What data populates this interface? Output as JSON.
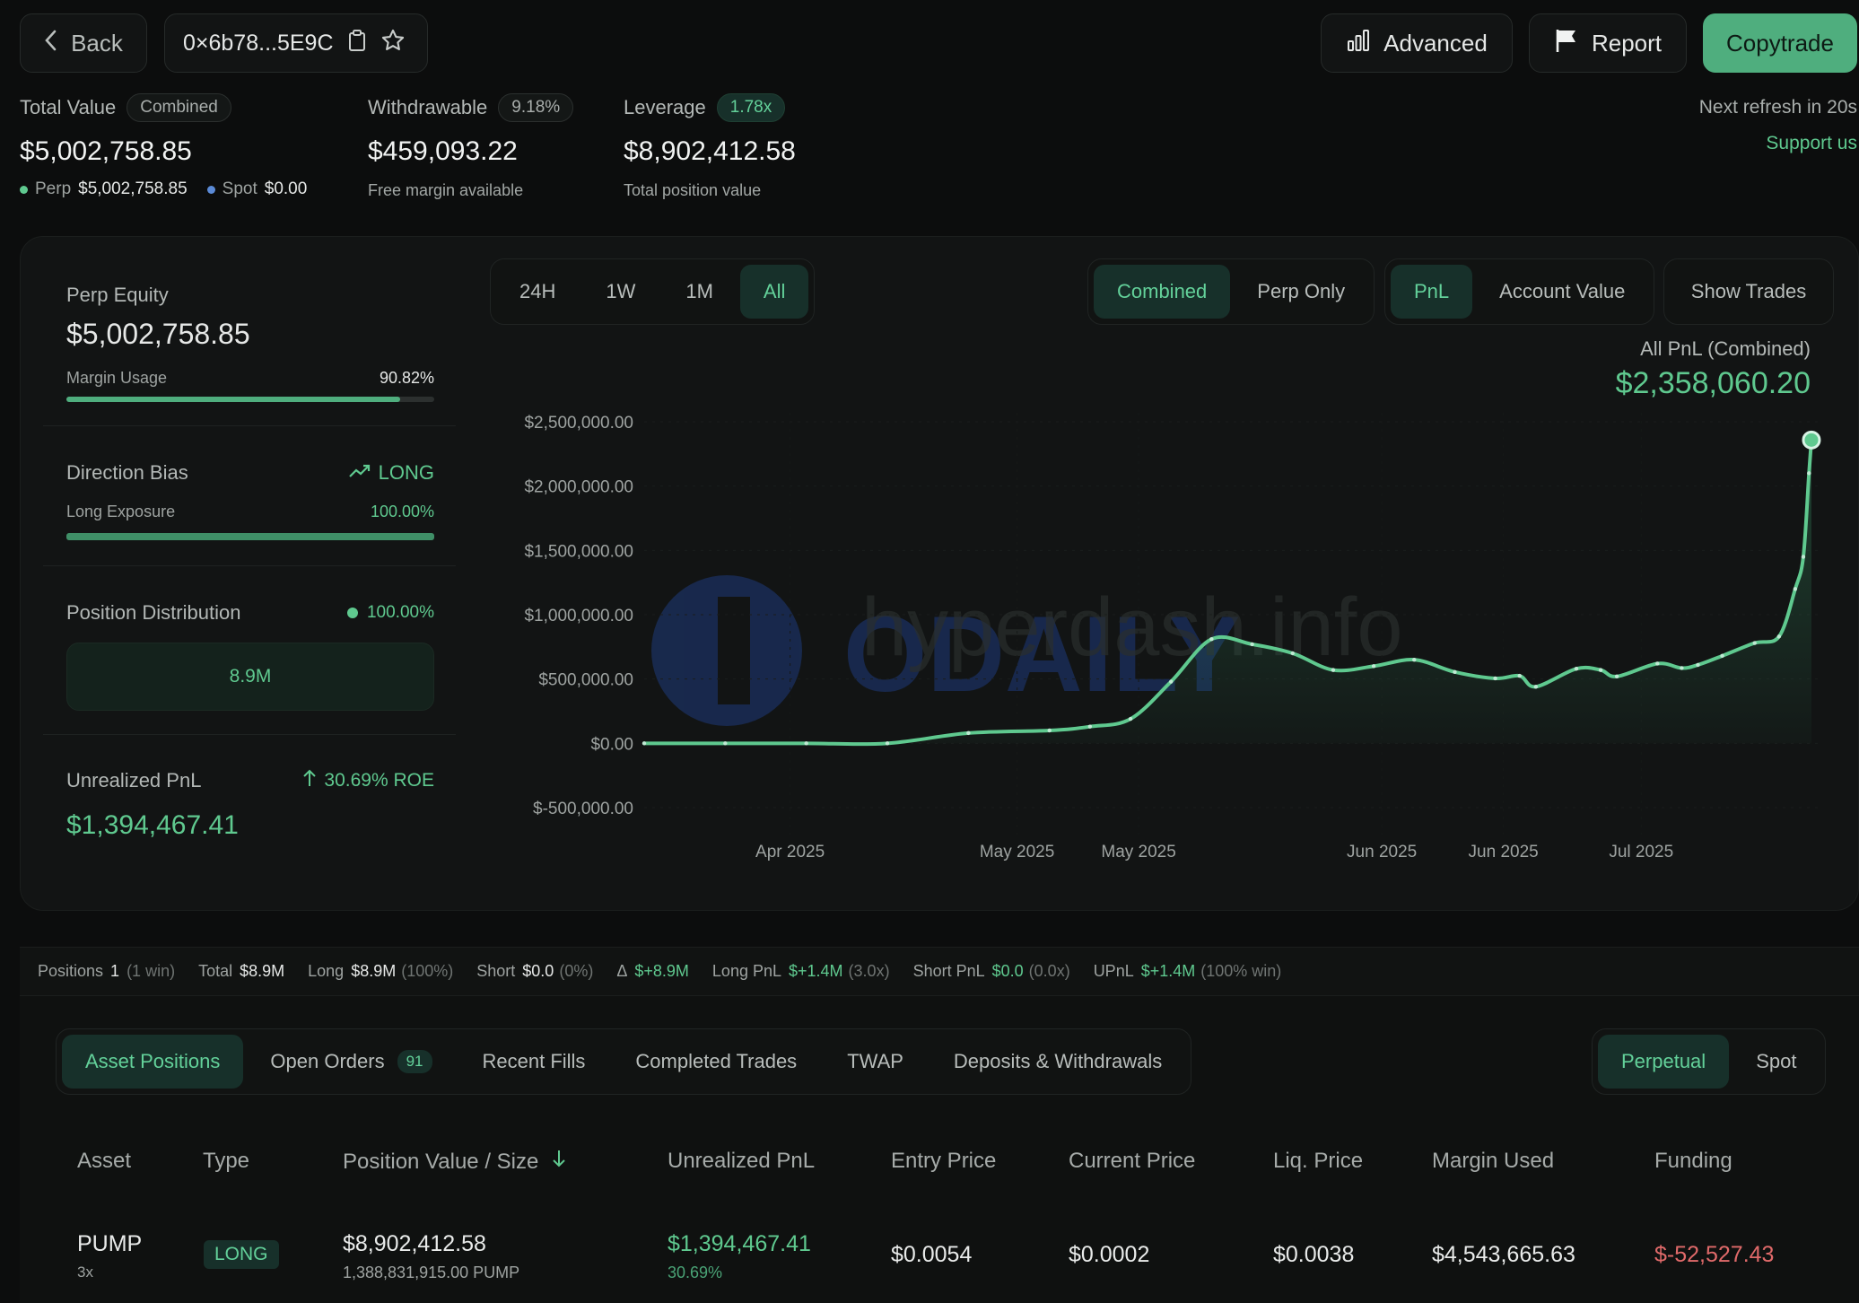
{
  "header": {
    "back_label": "Back",
    "address": "0×6b78...5E9C",
    "advanced_label": "Advanced",
    "report_label": "Report",
    "copytrade_label": "Copytrade"
  },
  "stats": {
    "total_value": {
      "label": "Total Value",
      "badge": "Combined",
      "value": "$5,002,758.85",
      "perp_label": "Perp",
      "perp_value": "$5,002,758.85",
      "spot_label": "Spot",
      "spot_value": "$0.00"
    },
    "withdrawable": {
      "label": "Withdrawable",
      "badge": "9.18%",
      "value": "$459,093.22",
      "sub": "Free margin available"
    },
    "leverage": {
      "label": "Leverage",
      "badge": "1.78x",
      "value": "$8,902,412.58",
      "sub": "Total position value"
    },
    "refresh": "Next refresh in 20s",
    "support": "Support us"
  },
  "left_panel": {
    "perp_equity_label": "Perp Equity",
    "perp_equity_value": "$5,002,758.85",
    "margin_usage_label": "Margin Usage",
    "margin_usage_value": "90.82%",
    "margin_usage_fraction": 0.9082,
    "direction_label": "Direction Bias",
    "direction_value": "LONG",
    "long_exposure_label": "Long Exposure",
    "long_exposure_value": "100.00%",
    "long_exposure_fraction": 1.0,
    "distribution_label": "Position Distribution",
    "distribution_value": "100.00%",
    "distribution_box": "8.9M",
    "upnl_label": "Unrealized PnL",
    "upnl_roe": "30.69% ROE",
    "upnl_value": "$1,394,467.41"
  },
  "chart_controls": {
    "ranges": [
      "24H",
      "1W",
      "1M",
      "All"
    ],
    "active_range": "All",
    "modes": [
      "Combined",
      "Perp Only"
    ],
    "metrics": [
      "PnL",
      "Account Value"
    ],
    "show_trades": "Show Trades"
  },
  "chart_data": {
    "type": "area",
    "title": "All PnL (Combined)",
    "headline_value": "$2,358,060.20",
    "ylim": [
      -500000,
      2500000
    ],
    "y_ticks": [
      2500000,
      2000000,
      1500000,
      1000000,
      500000,
      0,
      -500000
    ],
    "y_tick_labels": [
      "$2,500,000.00",
      "$2,000,000.00",
      "$1,500,000.00",
      "$1,000,000.00",
      "$500,000.00",
      "$0.00",
      "$-500,000.00"
    ],
    "x_tick_labels": [
      "Apr 2025",
      "May 2025",
      "May 2025",
      "Jun 2025",
      "Jun 2025",
      "Jul 2025"
    ],
    "x_tick_days": [
      18,
      46,
      61,
      91,
      106,
      123
    ],
    "xlim_days": [
      0,
      145
    ],
    "series": [
      {
        "x_days": [
          0,
          10,
          20,
          30,
          40,
          50,
          55,
          60,
          65,
          70,
          75,
          80,
          85,
          90,
          95,
          100,
          105,
          108,
          110,
          115,
          118,
          120,
          125,
          128,
          130,
          133,
          137,
          140,
          142,
          143,
          143.7,
          144
        ],
        "values": [
          0,
          0,
          0,
          0,
          80000,
          100000,
          130000,
          190000,
          480000,
          810000,
          770000,
          700000,
          570000,
          600000,
          650000,
          555000,
          505000,
          525000,
          440000,
          580000,
          570000,
          520000,
          620000,
          585000,
          610000,
          680000,
          780000,
          830000,
          1200000,
          1450000,
          2100000,
          2358060
        ]
      }
    ]
  },
  "summary_bar": {
    "positions_label": "Positions",
    "positions_value": "1",
    "positions_note": "(1 win)",
    "total_label": "Total",
    "total_value": "$8.9M",
    "long_label": "Long",
    "long_value": "$8.9M",
    "long_note": "(100%)",
    "short_label": "Short",
    "short_value": "$0.0",
    "short_note": "(0%)",
    "delta_label": "Δ",
    "delta_value": "$+8.9M",
    "long_pnl_label": "Long PnL",
    "long_pnl_value": "$+1.4M",
    "long_pnl_note": "(3.0x)",
    "short_pnl_label": "Short PnL",
    "short_pnl_value": "$0.0",
    "short_pnl_note": "(0.0x)",
    "upnl_label": "UPnL",
    "upnl_value": "$+1.4M",
    "upnl_note": "(100% win)"
  },
  "tabs": {
    "items": [
      "Asset Positions",
      "Open Orders",
      "Recent Fills",
      "Completed Trades",
      "TWAP",
      "Deposits & Withdrawals"
    ],
    "open_orders_count": "91",
    "active": "Asset Positions",
    "market": [
      "Perpetual",
      "Spot"
    ],
    "active_market": "Perpetual"
  },
  "table": {
    "headers": [
      "Asset",
      "Type",
      "Position Value / Size",
      "Unrealized PnL",
      "Entry Price",
      "Current Price",
      "Liq. Price",
      "Margin Used",
      "Funding"
    ],
    "rows": [
      {
        "asset": "PUMP",
        "leverage": "3x",
        "type": "LONG",
        "position_value": "$8,902,412.58",
        "size": "1,388,831,915.00 PUMP",
        "upnl": "$1,394,467.41",
        "upnl_pct": "30.69%",
        "entry": "$0.0054",
        "current": "$0.0002",
        "liq": "$0.0038",
        "margin": "$4,543,665.63",
        "funding": "$-52,527.43"
      }
    ]
  },
  "colors": {
    "accent": "#5fc98f",
    "negative": "#e06a6a",
    "background": "#0c0d0d"
  },
  "watermark": {
    "brand": "ODAILY",
    "site": "hyperdash.info"
  }
}
